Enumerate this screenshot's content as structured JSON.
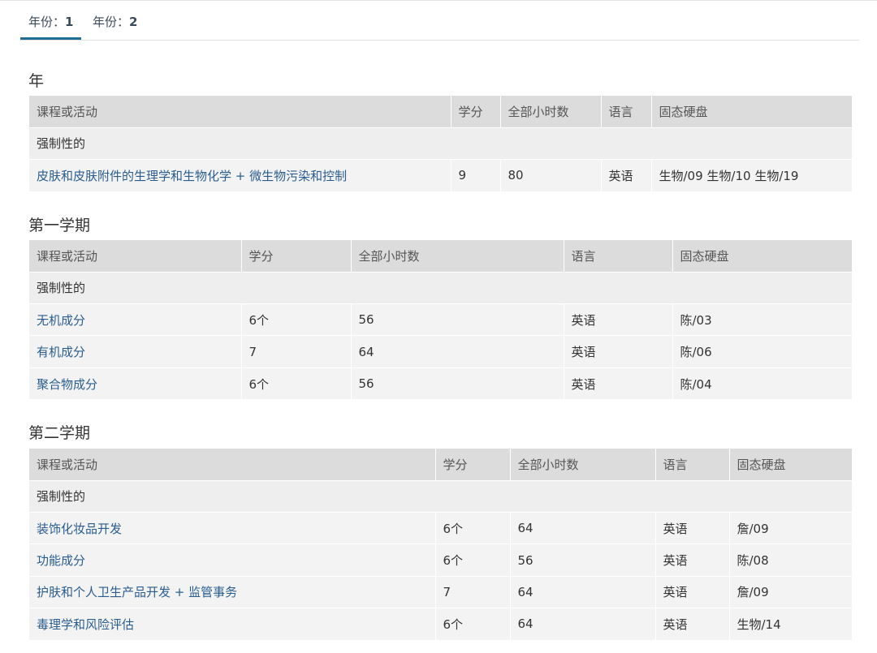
{
  "tabs": [
    {
      "label": "年份：",
      "num": "1"
    },
    {
      "label": "年份：",
      "num": "2"
    }
  ],
  "headers": {
    "course": "课程或活动",
    "credits": "学分",
    "hours": "全部小时数",
    "language": "语言",
    "ssd": "固态硬盘"
  },
  "sections": [
    {
      "title": "年",
      "group": "强制性的",
      "rows": [
        {
          "course": "皮肤和皮肤附件的生理学和生物化学 + 微生物污染和控制",
          "credits": "9",
          "hours": "80",
          "language": "英语",
          "ssd": "生物/09 生物/10 生物/19"
        }
      ]
    },
    {
      "title": "第一学期",
      "group": "强制性的",
      "rows": [
        {
          "course": "无机成分",
          "credits": "6个",
          "hours": "56",
          "language": "英语",
          "ssd": "陈/03"
        },
        {
          "course": "有机成分",
          "credits": "7",
          "hours": "64",
          "language": "英语",
          "ssd": "陈/06"
        },
        {
          "course": "聚合物成分",
          "credits": "6个",
          "hours": "56",
          "language": "英语",
          "ssd": "陈/04"
        }
      ]
    },
    {
      "title": "第二学期",
      "group": "强制性的",
      "rows": [
        {
          "course": "装饰化妆品开发",
          "credits": "6个",
          "hours": "64",
          "language": "英语",
          "ssd": "詹/09"
        },
        {
          "course": "功能成分",
          "credits": "6个",
          "hours": "56",
          "language": "英语",
          "ssd": "陈/08"
        },
        {
          "course": "护肤和个人卫生产品开发 + 监管事务",
          "credits": "7",
          "hours": "64",
          "language": "英语",
          "ssd": "詹/09"
        },
        {
          "course": "毒理学和风险评估",
          "credits": "6个",
          "hours": "64",
          "language": "英语",
          "ssd": "生物/14"
        }
      ]
    }
  ]
}
